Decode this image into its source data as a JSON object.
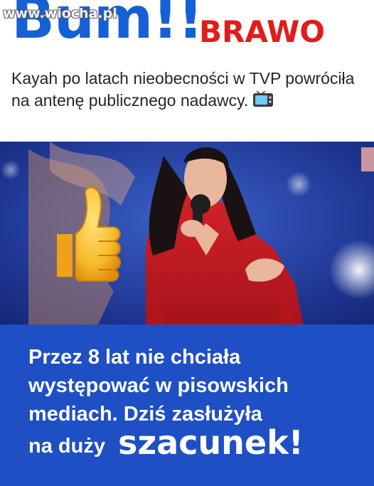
{
  "header": {
    "headline": "Bum!!",
    "accent": "BRAWO",
    "watermark": "www.wiocha.pl"
  },
  "intro": {
    "text": "Kayah po latach nieobecności w TVP powróciła na antenę publicznego nadawcy.",
    "emoji": "tv-icon"
  },
  "photo": {
    "emoji": "thumbs-up-icon"
  },
  "caption": {
    "line1": "Przez 8 lat nie chciała",
    "line2": "występować w pisowskich",
    "line3": "mediach. Dziś zasłużyła",
    "line4": "na duży",
    "big_word": "szacunek!"
  },
  "colors": {
    "headline_blue": "#1560d4",
    "accent_red": "#e31b1b",
    "caption_bg": "#1f4fc4"
  }
}
